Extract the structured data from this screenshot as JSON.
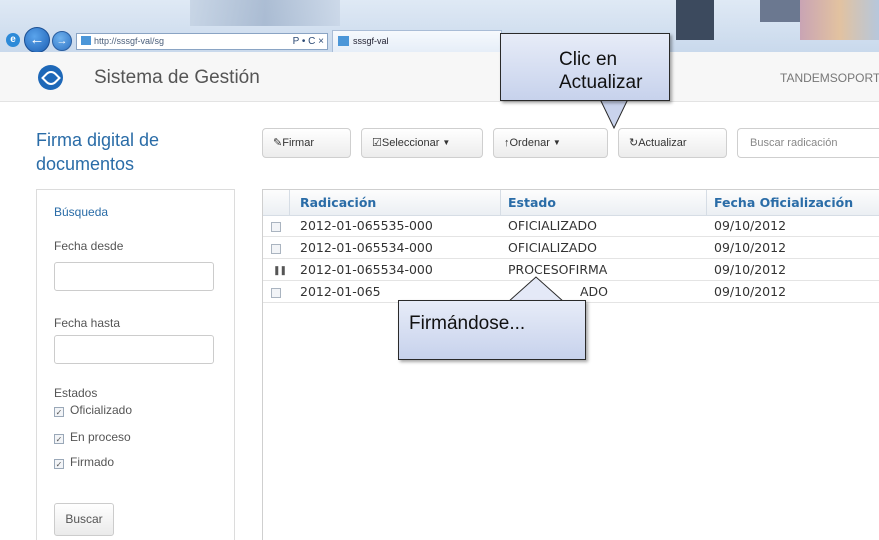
{
  "browser": {
    "address": "http://sssgf-val/sg",
    "address_controls": "Ρ • C ×",
    "tab_label": "sssgf-val"
  },
  "app": {
    "title": "Sistema de Gestión",
    "user": "TANDEMSOPORTE",
    "brand_color": "#1e68b8"
  },
  "page": {
    "heading": "Firma digital de documentos"
  },
  "sidebar": {
    "title": "Búsqueda",
    "fecha_desde_label": "Fecha desde",
    "fecha_hasta_label": "Fecha hasta",
    "estados_label": "Estados",
    "estados": [
      {
        "label": "Oficializado",
        "checked": true
      },
      {
        "label": "En proceso",
        "checked": true
      },
      {
        "label": "Firmado",
        "checked": true
      }
    ],
    "search_button": "Buscar"
  },
  "toolbar": {
    "firmar": "Firmar",
    "seleccionar": "Seleccionar",
    "ordenar": "Ordenar",
    "actualizar": "Actualizar",
    "search_placeholder": "Buscar radicación"
  },
  "grid": {
    "columns": [
      "Radicación",
      "Estado",
      "Fecha Oficialización"
    ],
    "rows": [
      {
        "radicacion": "2012-01-065535-000",
        "estado": "OFICIALIZADO",
        "fecha": "09/10/2012",
        "marker": "checkbox"
      },
      {
        "radicacion": "2012-01-065534-000",
        "estado": "OFICIALIZADO",
        "fecha": "09/10/2012",
        "marker": "checkbox"
      },
      {
        "radicacion": "2012-01-065534-000",
        "estado": "PROCESOFIRMA",
        "fecha": "09/10/2012",
        "marker": "progress"
      },
      {
        "radicacion": "2012-01-065",
        "estado": "ADO",
        "fecha": "09/10/2012",
        "marker": "checkbox"
      }
    ]
  },
  "callouts": {
    "actualizar_line1": "Clic en",
    "actualizar_line2": "Actualizar",
    "firmando": "Firmándose..."
  }
}
